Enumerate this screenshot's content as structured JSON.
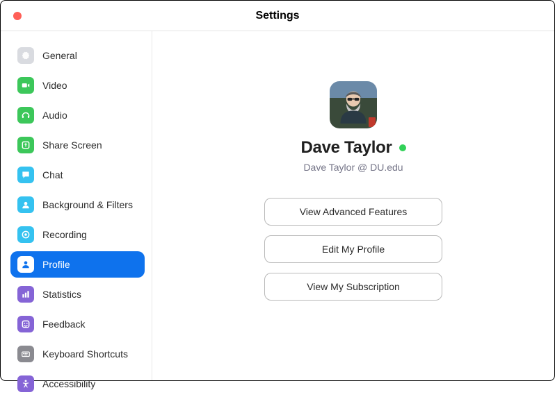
{
  "window": {
    "title": "Settings"
  },
  "sidebar": {
    "items": [
      {
        "label": "General",
        "icon": "gear-icon",
        "bg": "#d9dbe0",
        "fg": "#ffffff"
      },
      {
        "label": "Video",
        "icon": "video-icon",
        "bg": "#3cc75a",
        "fg": "#ffffff"
      },
      {
        "label": "Audio",
        "icon": "audio-icon",
        "bg": "#3cc75a",
        "fg": "#ffffff"
      },
      {
        "label": "Share Screen",
        "icon": "share-icon",
        "bg": "#3cc75a",
        "fg": "#ffffff"
      },
      {
        "label": "Chat",
        "icon": "chat-icon",
        "bg": "#35c2f0",
        "fg": "#ffffff"
      },
      {
        "label": "Background & Filters",
        "icon": "person-bg-icon",
        "bg": "#35c2f0",
        "fg": "#ffffff"
      },
      {
        "label": "Recording",
        "icon": "record-icon",
        "bg": "#35c2f0",
        "fg": "#ffffff"
      },
      {
        "label": "Profile",
        "icon": "profile-icon",
        "bg": "#ffffff",
        "fg": "#0e72ed",
        "active": true,
        "activeBg": "#0e72ed"
      },
      {
        "label": "Statistics",
        "icon": "stats-icon",
        "bg": "#8564d6",
        "fg": "#ffffff"
      },
      {
        "label": "Feedback",
        "icon": "feedback-icon",
        "bg": "#8564d6",
        "fg": "#ffffff"
      },
      {
        "label": "Keyboard Shortcuts",
        "icon": "keyboard-icon",
        "bg": "#8a8a90",
        "fg": "#ffffff"
      },
      {
        "label": "Accessibility",
        "icon": "a11y-icon",
        "bg": "#8564d6",
        "fg": "#ffffff"
      }
    ]
  },
  "profile": {
    "display_name": "Dave Taylor",
    "email": "Dave Taylor @ DU.edu",
    "status_color": "#31d158",
    "buttons": {
      "advanced": "View Advanced Features",
      "edit": "Edit My Profile",
      "subscription": "View My Subscription"
    }
  }
}
